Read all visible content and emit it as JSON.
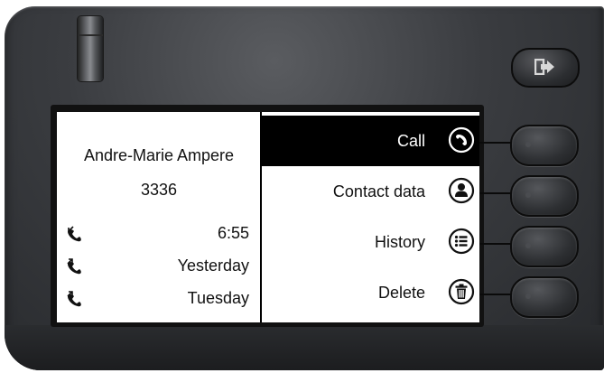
{
  "contact": {
    "name": "Andre-Marie Ampere",
    "number": "3336"
  },
  "history": [
    {
      "icon": "incoming-call-icon",
      "time": "6:55"
    },
    {
      "icon": "outgoing-call-icon",
      "time": "Yesterday"
    },
    {
      "icon": "outgoing-call-icon",
      "time": "Tuesday"
    }
  ],
  "menu": [
    {
      "label": "Call",
      "icon": "handset-icon",
      "selected": true
    },
    {
      "label": "Contact data",
      "icon": "person-icon",
      "selected": false
    },
    {
      "label": "History",
      "icon": "list-icon",
      "selected": false
    },
    {
      "label": "Delete",
      "icon": "trash-icon",
      "selected": false
    }
  ],
  "exit_key": {
    "icon": "exit-arrow-icon"
  },
  "colors": {
    "selected_bg": "#000000",
    "screen_bg": "#ffffff",
    "body": "#3a3c40"
  }
}
